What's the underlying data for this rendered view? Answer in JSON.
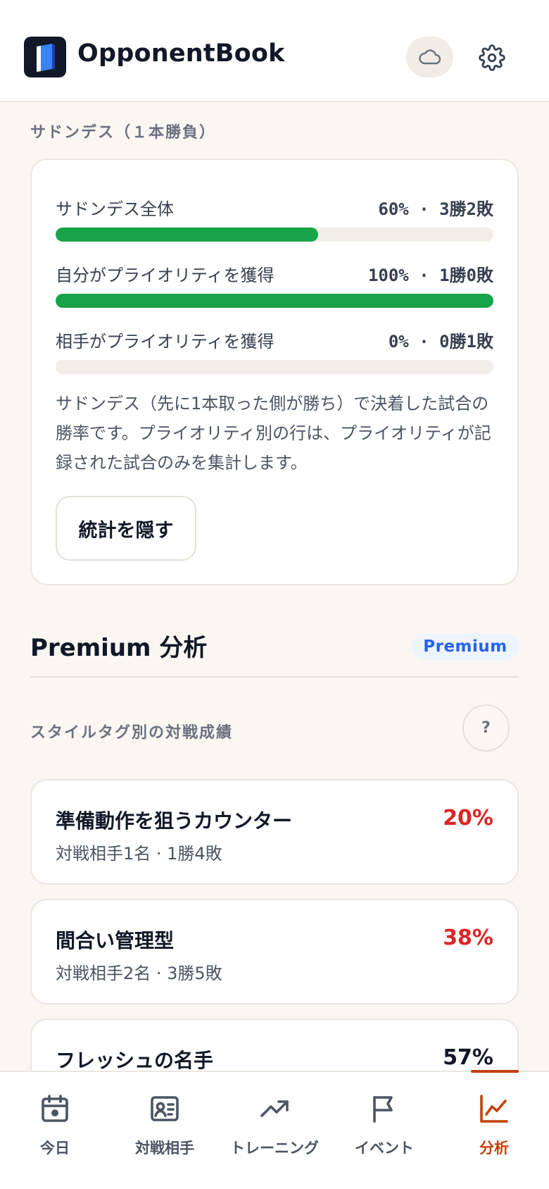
{
  "header": {
    "app_title": "OpponentBook"
  },
  "sudden_death": {
    "section_label": "サドンデス（１本勝負）",
    "rows": [
      {
        "label": "サドンデス全体",
        "value": "60% · 3勝2敗",
        "fill": 0.6
      },
      {
        "label": "自分がプライオリティを獲得",
        "value": "100% · 1勝0敗",
        "fill": 1.0
      },
      {
        "label": "相手がプライオリティを獲得",
        "value": "0% · 0勝1敗",
        "fill": 0.0
      }
    ],
    "description": "サドンデス（先に1本取った側が勝ち）で決着した試合の勝率です。プライオリティ別の行は、プライオリティが記録された試合のみを集計します。",
    "hide_button": "統計を隠す"
  },
  "premium": {
    "title": "Premium 分析",
    "badge": "Premium",
    "subsection_label": "スタイルタグ別の対戦成績",
    "help_label": "?",
    "styles": [
      {
        "name": "準備動作を狙うカウンター",
        "sub": "対戦相手1名 · 1勝4敗",
        "pct": "20%",
        "color": "#dc2626"
      },
      {
        "name": "間合い管理型",
        "sub": "対戦相手2名 · 3勝5敗",
        "pct": "38%",
        "color": "#dc2626"
      },
      {
        "name": "フレッシュの名手",
        "sub": "",
        "pct": "57%",
        "color": "#111827"
      }
    ]
  },
  "nav": {
    "items": [
      {
        "label": "今日",
        "icon": "calendar-icon"
      },
      {
        "label": "対戦相手",
        "icon": "contact-card-icon"
      },
      {
        "label": "トレーニング",
        "icon": "trend-up-icon"
      },
      {
        "label": "イベント",
        "icon": "flag-icon"
      },
      {
        "label": "分析",
        "icon": "chart-line-icon"
      }
    ],
    "active_index": 4,
    "active_color": "#c2410c"
  }
}
